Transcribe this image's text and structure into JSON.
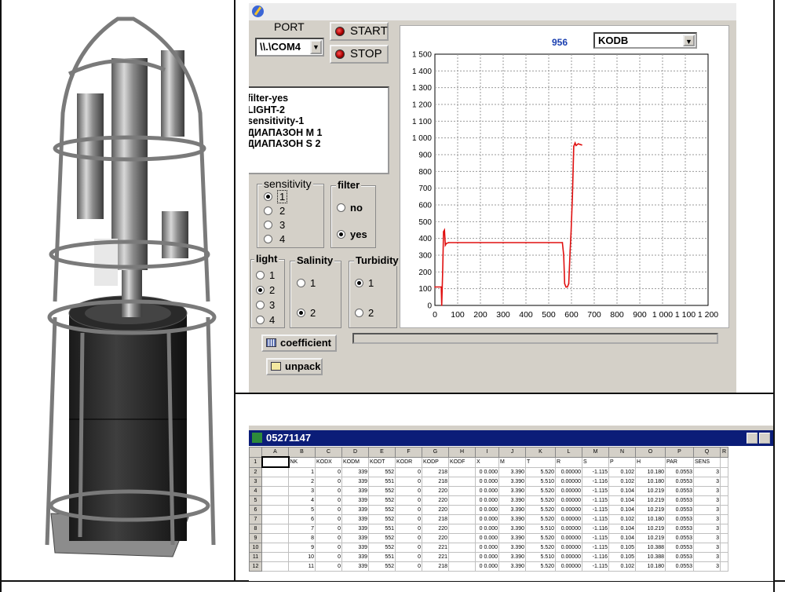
{
  "control_panel": {
    "port_label": "PORT",
    "port_value": "\\\\.\\COM4",
    "start_label": "START",
    "stop_label": "STOP",
    "status_lines": [
      "filter-yes",
      "LIGHT-2",
      "sensitivity-1",
      "ДИАПАЗОН M  1",
      "ДИАПАЗОН S  2"
    ],
    "counter": "956",
    "channel_select": "KODB",
    "sensitivity": {
      "title": "sensitivity",
      "options": [
        "1",
        "2",
        "3",
        "4"
      ],
      "selected": "1"
    },
    "filter": {
      "title": "filter",
      "options": [
        "no",
        "yes"
      ],
      "selected": "yes"
    },
    "light": {
      "title": "light",
      "options": [
        "1",
        "2",
        "3",
        "4"
      ],
      "selected": "2"
    },
    "salinity": {
      "title": "Salinity",
      "options": [
        "1",
        "2"
      ],
      "selected": "2"
    },
    "turbidity": {
      "title": "Turbidity",
      "options": [
        "1",
        "2"
      ],
      "selected": "1"
    },
    "coefficient_label": "coefficient",
    "unpack_label": "unpack",
    "colors": {
      "trace": "#e01010",
      "counter": "#1a3fb0"
    }
  },
  "chart_data": {
    "type": "line",
    "title": "",
    "xlabel": "",
    "ylabel": "",
    "xlim": [
      0,
      1200
    ],
    "ylim": [
      0,
      1500
    ],
    "xticks": [
      0,
      100,
      200,
      300,
      400,
      500,
      600,
      700,
      800,
      900,
      1000,
      1100,
      1200
    ],
    "xtick_labels": [
      "0",
      "100",
      "200",
      "300",
      "400",
      "500",
      "600",
      "700",
      "800",
      "900",
      "1 000",
      "1 100",
      "1 200"
    ],
    "yticks": [
      0,
      100,
      200,
      300,
      400,
      500,
      600,
      700,
      800,
      900,
      1000,
      1100,
      1200,
      1300,
      1400,
      1500
    ],
    "ytick_labels": [
      "0",
      "100",
      "200",
      "300",
      "400",
      "500",
      "600",
      "700",
      "800",
      "900",
      "1 000",
      "1 100",
      "1 200",
      "1 300",
      "1 400",
      "1 500"
    ],
    "grid": true,
    "series": [
      {
        "x": [
          0,
          28,
          30,
          34,
          38,
          42,
          46,
          50,
          60,
          100,
          200,
          300,
          400,
          500,
          560,
          566,
          570,
          576,
          582,
          588,
          594,
          598,
          604,
          610,
          616,
          620,
          630,
          640,
          645
        ],
        "y": [
          110,
          110,
          0,
          200,
          440,
          450,
          360,
          370,
          375,
          375,
          375,
          375,
          375,
          375,
          375,
          300,
          130,
          110,
          110,
          130,
          330,
          430,
          650,
          950,
          970,
          955,
          965,
          960,
          958
        ]
      }
    ]
  },
  "spreadsheet": {
    "title": "05271147",
    "col_letters": [
      "A",
      "B",
      "C",
      "D",
      "E",
      "F",
      "G",
      "H",
      "I",
      "J",
      "K",
      "L",
      "M",
      "N",
      "O",
      "P",
      "Q",
      "R"
    ],
    "headers": [
      "",
      "NK",
      "KODX",
      "KODM",
      "KODT",
      "KODR",
      "KODP",
      "KODF",
      "X",
      "M",
      "T",
      "R",
      "S",
      "P",
      "H",
      "PAR",
      "SENS",
      ""
    ],
    "rows": [
      [
        "",
        "1",
        "0",
        "339",
        "552",
        "0",
        "218",
        "",
        "0 0.000",
        "3.390",
        "5.520",
        "0.00000",
        "-1.115",
        "0.102",
        "10.180",
        "0.0553",
        "3",
        ""
      ],
      [
        "",
        "2",
        "0",
        "339",
        "551",
        "0",
        "218",
        "",
        "0 0.000",
        "3.390",
        "5.510",
        "0.00000",
        "-1.116",
        "0.102",
        "10.180",
        "0.0553",
        "3",
        ""
      ],
      [
        "",
        "3",
        "0",
        "339",
        "552",
        "0",
        "220",
        "",
        "0 0.000",
        "3.390",
        "5.520",
        "0.00000",
        "-1.115",
        "0.104",
        "10.219",
        "0.0553",
        "3",
        ""
      ],
      [
        "",
        "4",
        "0",
        "339",
        "552",
        "0",
        "220",
        "",
        "0 0.000",
        "3.390",
        "5.520",
        "0.00000",
        "-1.115",
        "0.104",
        "10.219",
        "0.0553",
        "3",
        ""
      ],
      [
        "",
        "5",
        "0",
        "339",
        "552",
        "0",
        "220",
        "",
        "0 0.000",
        "3.390",
        "5.520",
        "0.00000",
        "-1.115",
        "0.104",
        "10.219",
        "0.0553",
        "3",
        ""
      ],
      [
        "",
        "6",
        "0",
        "339",
        "552",
        "0",
        "218",
        "",
        "0 0.000",
        "3.390",
        "5.520",
        "0.00000",
        "-1.115",
        "0.102",
        "10.180",
        "0.0553",
        "3",
        ""
      ],
      [
        "",
        "7",
        "0",
        "339",
        "551",
        "0",
        "220",
        "",
        "0 0.000",
        "3.390",
        "5.510",
        "0.00000",
        "-1.116",
        "0.104",
        "10.219",
        "0.0553",
        "3",
        ""
      ],
      [
        "",
        "8",
        "0",
        "339",
        "552",
        "0",
        "220",
        "",
        "0 0.000",
        "3.390",
        "5.520",
        "0.00000",
        "-1.115",
        "0.104",
        "10.219",
        "0.0553",
        "3",
        ""
      ],
      [
        "",
        "9",
        "0",
        "339",
        "552",
        "0",
        "221",
        "",
        "0 0.000",
        "3.390",
        "5.520",
        "0.00000",
        "-1.115",
        "0.105",
        "10.388",
        "0.0553",
        "3",
        ""
      ],
      [
        "",
        "10",
        "0",
        "339",
        "551",
        "0",
        "221",
        "",
        "0 0.000",
        "3.390",
        "5.510",
        "0.00000",
        "-1.116",
        "0.105",
        "10.388",
        "0.0553",
        "3",
        ""
      ],
      [
        "",
        "11",
        "0",
        "339",
        "552",
        "0",
        "218",
        "",
        "0 0.000",
        "3.390",
        "5.520",
        "0.00000",
        "-1.115",
        "0.102",
        "10.180",
        "0.0553",
        "3",
        ""
      ]
    ]
  }
}
